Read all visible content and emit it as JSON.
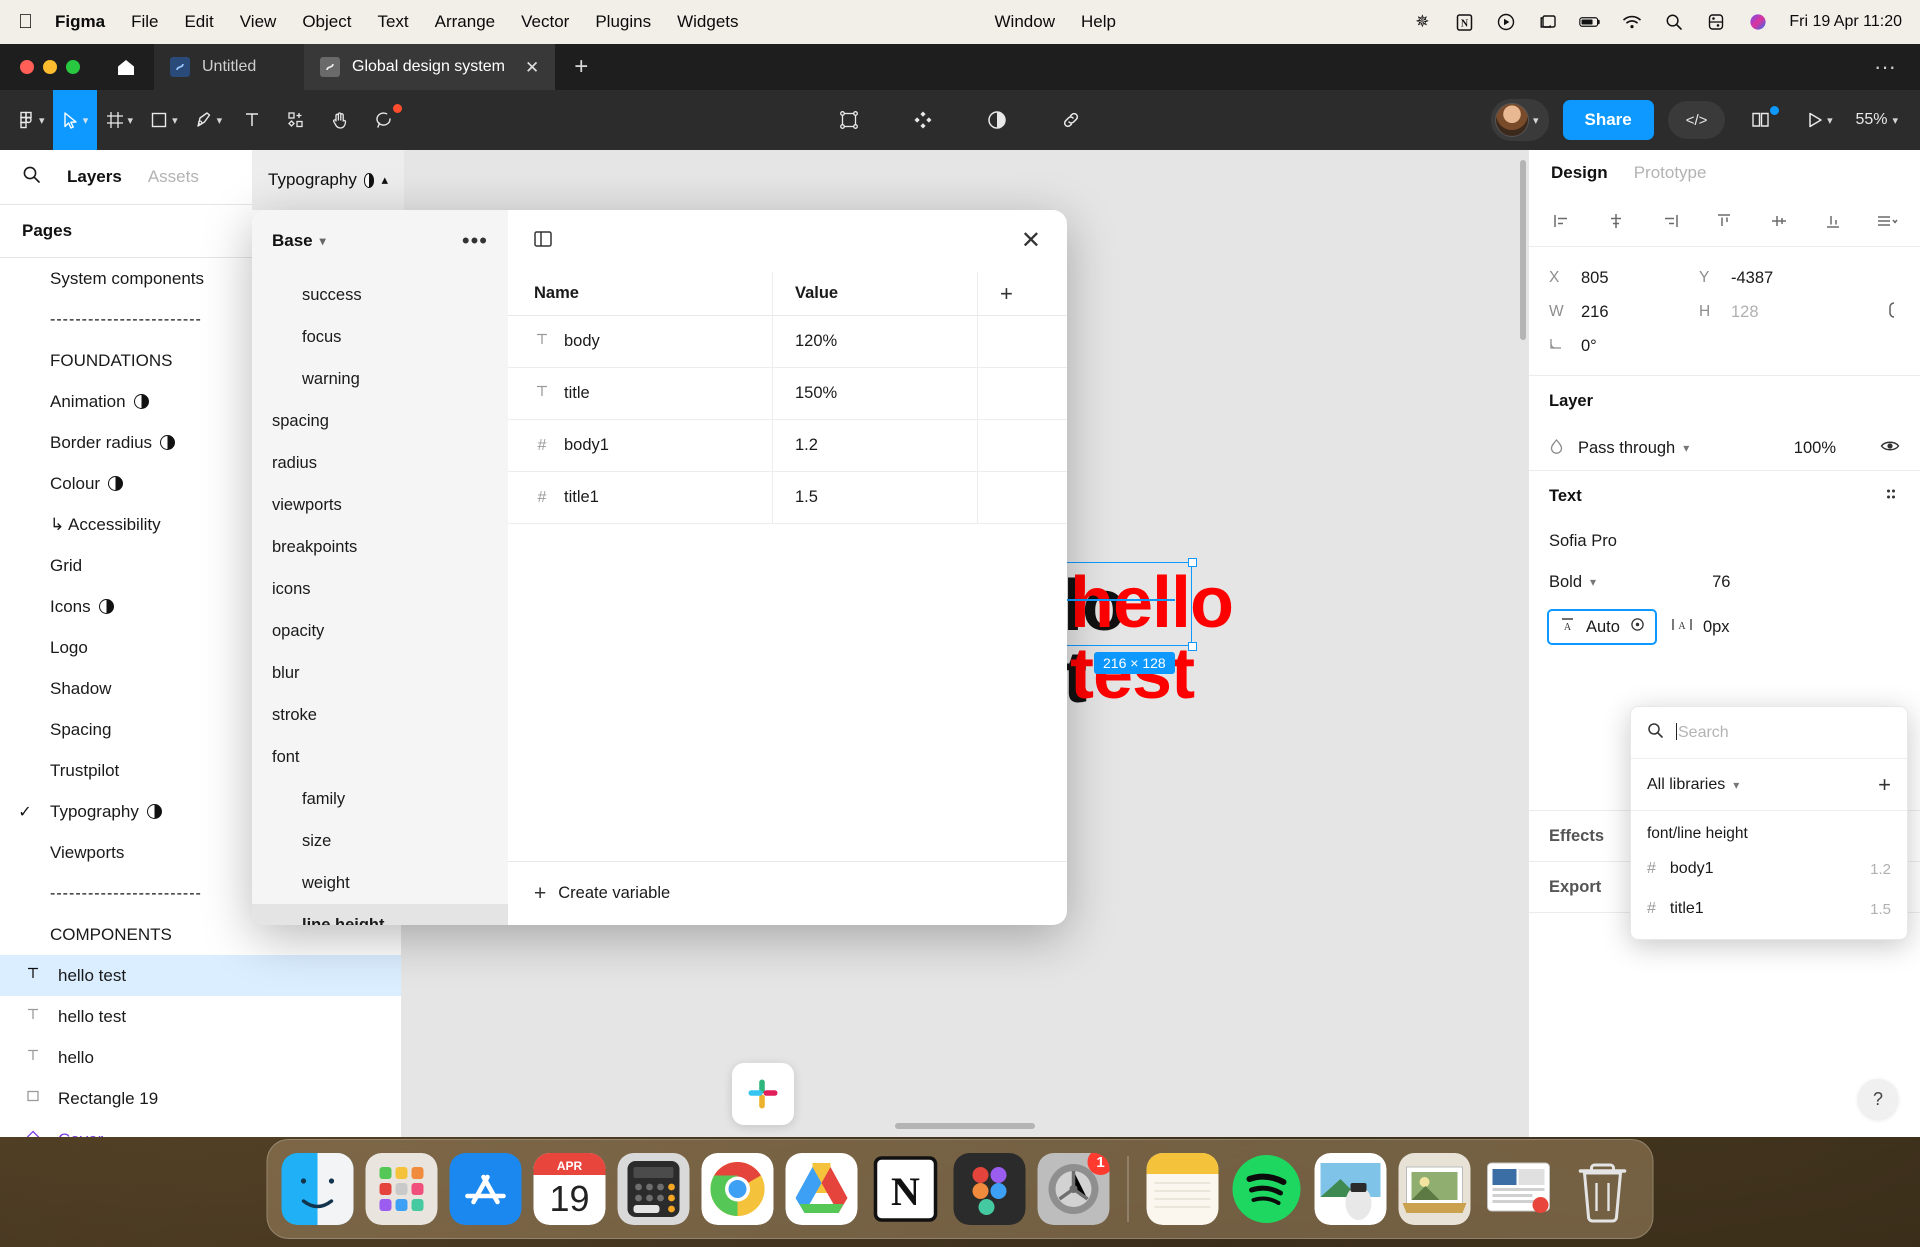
{
  "menubar": {
    "apple_icon": "apple-icon",
    "items": [
      {
        "label": "Figma",
        "bold": true
      },
      {
        "label": "File",
        "bold": false
      },
      {
        "label": "Edit",
        "bold": false
      },
      {
        "label": "View",
        "bold": false
      },
      {
        "label": "Object",
        "bold": false
      },
      {
        "label": "Text",
        "bold": false
      },
      {
        "label": "Arrange",
        "bold": false
      },
      {
        "label": "Vector",
        "bold": false
      },
      {
        "label": "Plugins",
        "bold": false
      },
      {
        "label": "Widgets",
        "bold": false
      }
    ],
    "right_items": [
      {
        "label": "Window"
      },
      {
        "label": "Help"
      }
    ],
    "status_icons": [
      "asterisk-icon",
      "notion-icon",
      "play-circle-icon",
      "screen-mirror-icon",
      "battery-icon",
      "wifi-icon",
      "search-icon",
      "control-center-icon",
      "siri-icon"
    ],
    "clock": "Fri 19 Apr  11:20"
  },
  "window": {
    "tabs": [
      {
        "label": "Untitled",
        "active": false
      },
      {
        "label": "Global design system",
        "active": true
      }
    ],
    "new_tab_label": "+",
    "overflow_label": "···"
  },
  "toolbar": {
    "left_tools": [
      {
        "name": "figma-menu-icon",
        "glyph": "figma",
        "caret": true,
        "selected": false
      },
      {
        "name": "move-tool-icon",
        "glyph": "cursor",
        "caret": true,
        "selected": true
      },
      {
        "name": "frame-tool-icon",
        "glyph": "frame",
        "caret": true,
        "selected": false
      },
      {
        "name": "shape-tool-icon",
        "glyph": "square",
        "caret": true,
        "selected": false
      },
      {
        "name": "pen-tool-icon",
        "glyph": "pen",
        "caret": true,
        "selected": false
      },
      {
        "name": "text-tool-icon",
        "glyph": "text",
        "caret": false,
        "selected": false
      },
      {
        "name": "actions-tool-icon",
        "glyph": "actions",
        "caret": false,
        "selected": false
      },
      {
        "name": "hand-tool-icon",
        "glyph": "hand",
        "caret": false,
        "selected": false
      },
      {
        "name": "comment-tool-icon",
        "glyph": "comment",
        "caret": false,
        "selected": false
      }
    ],
    "center_tools": [
      {
        "name": "component-icon",
        "glyph": "component"
      },
      {
        "name": "assets-grid-icon",
        "glyph": "diamond"
      },
      {
        "name": "styles-icon",
        "glyph": "halfcircle"
      },
      {
        "name": "link-icon",
        "glyph": "link"
      }
    ],
    "share_label": "Share",
    "code_label": "</>",
    "zoom_label": "55%",
    "right_icons": [
      "book-icon",
      "present-icon"
    ]
  },
  "left_panel": {
    "tabs": [
      {
        "label": "Layers",
        "active": true
      },
      {
        "label": "Assets",
        "active": false
      }
    ],
    "search_icon": "search-icon",
    "pages_header": "Pages",
    "pages": [
      {
        "label": "System components",
        "checked": false,
        "half": false,
        "type": "page"
      },
      {
        "label": "------------------------",
        "type": "divider"
      },
      {
        "label": "FOUNDATIONS",
        "type": "group"
      },
      {
        "label": "Animation",
        "checked": false,
        "half": true,
        "type": "page"
      },
      {
        "label": "Border radius",
        "checked": false,
        "half": true,
        "type": "page"
      },
      {
        "label": "Colour",
        "checked": false,
        "half": true,
        "type": "page"
      },
      {
        "label": "↳ Accessibility",
        "checked": false,
        "half": false,
        "type": "page"
      },
      {
        "label": "Grid",
        "checked": false,
        "half": false,
        "type": "page"
      },
      {
        "label": "Icons",
        "checked": false,
        "half": true,
        "type": "page"
      },
      {
        "label": "Logo",
        "checked": false,
        "half": false,
        "type": "page"
      },
      {
        "label": "Shadow",
        "checked": false,
        "half": false,
        "type": "page"
      },
      {
        "label": "Spacing",
        "checked": false,
        "half": false,
        "type": "page"
      },
      {
        "label": "Trustpilot",
        "checked": false,
        "half": false,
        "type": "page"
      },
      {
        "label": "Typography",
        "checked": true,
        "half": true,
        "type": "page"
      },
      {
        "label": "Viewports",
        "checked": false,
        "half": false,
        "type": "page"
      },
      {
        "label": "------------------------",
        "type": "divider"
      },
      {
        "label": "COMPONENTS",
        "type": "group"
      }
    ],
    "layers": [
      {
        "label": "hello test",
        "icon": "text-layer-icon",
        "selected": true
      },
      {
        "label": "hello test",
        "icon": "text-layer-icon",
        "selected": false
      },
      {
        "label": "hello",
        "icon": "text-layer-icon",
        "selected": false
      },
      {
        "label": "Rectangle 19",
        "icon": "rectangle-layer-icon",
        "selected": false
      },
      {
        "label": "Cover",
        "icon": "component-layer-icon",
        "selected": false
      }
    ]
  },
  "typography_chip": {
    "label": "Typography",
    "half_icon": "half-circle-icon",
    "caret": "⌃"
  },
  "variables_modal": {
    "collection": "Base",
    "more_label": "•••",
    "panel_toggle_icon": "side-panel-icon",
    "close_icon": "close-icon",
    "groups": [
      {
        "label": "success",
        "indent": true,
        "selected": false
      },
      {
        "label": "focus",
        "indent": true,
        "selected": false
      },
      {
        "label": "warning",
        "indent": true,
        "selected": false
      },
      {
        "label": "spacing",
        "indent": false,
        "selected": false
      },
      {
        "label": "radius",
        "indent": false,
        "selected": false
      },
      {
        "label": "viewports",
        "indent": false,
        "selected": false
      },
      {
        "label": "breakpoints",
        "indent": false,
        "selected": false
      },
      {
        "label": "icons",
        "indent": false,
        "selected": false
      },
      {
        "label": "opacity",
        "indent": false,
        "selected": false
      },
      {
        "label": "blur",
        "indent": false,
        "selected": false
      },
      {
        "label": "stroke",
        "indent": false,
        "selected": false
      },
      {
        "label": "font",
        "indent": false,
        "selected": false
      },
      {
        "label": "family",
        "indent": true,
        "selected": false
      },
      {
        "label": "size",
        "indent": true,
        "selected": false
      },
      {
        "label": "weight",
        "indent": true,
        "selected": false
      },
      {
        "label": "line height",
        "indent": true,
        "selected": true
      }
    ],
    "table": {
      "columns": [
        "Name",
        "Value"
      ],
      "add_column_label": "+",
      "rows": [
        {
          "icon": "text-variable-icon",
          "name": "body",
          "value": "120%"
        },
        {
          "icon": "text-variable-icon",
          "name": "title",
          "value": "150%"
        },
        {
          "icon": "number-variable-icon",
          "name": "body1",
          "value": "1.2"
        },
        {
          "icon": "number-variable-icon",
          "name": "title1",
          "value": "1.5"
        }
      ]
    },
    "create_label": "Create variable"
  },
  "canvas": {
    "black_line1": "hello",
    "black_line2": "test",
    "red_line1": "hello",
    "red_line2": "test",
    "dimension_badge": "216 × 128",
    "selection_color": "#0d99ff",
    "red_color": "#ff0000"
  },
  "right_panel": {
    "tabs": [
      {
        "label": "Design",
        "active": true
      },
      {
        "label": "Prototype",
        "active": false
      }
    ],
    "align_icons": [
      "align-left-icon",
      "align-horizontal-center-icon",
      "align-right-icon",
      "align-top-icon",
      "align-vertical-center-icon",
      "align-bottom-icon",
      "align-more-icon"
    ],
    "transform": {
      "x_key": "X",
      "x_value": "805",
      "y_key": "Y",
      "y_value": "-4387",
      "w_key": "W",
      "w_value": "216",
      "h_key": "H",
      "h_value": "128",
      "rotation_value": "0°",
      "constrain_icon": "constrain-proportions-icon"
    },
    "layer_section": {
      "title": "Layer",
      "blend_mode": "Pass through",
      "opacity": "100%",
      "visibility_icon": "eye-icon"
    },
    "text_section": {
      "title": "Text",
      "settings_icon": "text-settings-icon",
      "font_family": "Sofia Pro",
      "font_weight": "Bold",
      "font_size": "76",
      "line_height": "Auto",
      "line_height_icon": "line-height-icon",
      "variable_icon": "variable-target-icon",
      "letter_spacing": "0px",
      "letter_spacing_icon": "letter-spacing-icon"
    },
    "effects_section": {
      "title": "Effects",
      "add": "+"
    },
    "export_section": {
      "title": "Export",
      "add": "+"
    },
    "help_label": "?"
  },
  "variable_picker": {
    "search_placeholder": "Search",
    "search_value": "",
    "search_icon": "search-icon",
    "library_filter": "All libraries",
    "add_label": "+",
    "group_label": "font/line height",
    "items": [
      {
        "icon": "number-variable-icon",
        "name": "body1",
        "value": "1.2"
      },
      {
        "icon": "number-variable-icon",
        "name": "title1",
        "value": "1.5"
      }
    ]
  },
  "dock": {
    "items": [
      {
        "name": "finder",
        "glyph": "finder"
      },
      {
        "name": "launchpad",
        "glyph": "launchpad"
      },
      {
        "name": "app-store",
        "glyph": "appstore"
      },
      {
        "name": "calendar",
        "glyph": "calendar",
        "month": "APR",
        "day": "19"
      },
      {
        "name": "calculator",
        "glyph": "calculator"
      },
      {
        "name": "chrome",
        "glyph": "chrome"
      },
      {
        "name": "google-drive",
        "glyph": "drive"
      },
      {
        "name": "notion",
        "glyph": "notion"
      },
      {
        "name": "figma",
        "glyph": "figma"
      },
      {
        "name": "system-settings",
        "glyph": "settings",
        "badge": "1"
      },
      {
        "name": "notes",
        "glyph": "notes"
      },
      {
        "name": "spotify",
        "glyph": "spotify"
      },
      {
        "name": "preview",
        "glyph": "preview"
      },
      {
        "name": "photos-folder",
        "glyph": "photosfolder"
      },
      {
        "name": "downloads-stack",
        "glyph": "downloads"
      },
      {
        "name": "trash",
        "glyph": "trash"
      }
    ]
  }
}
